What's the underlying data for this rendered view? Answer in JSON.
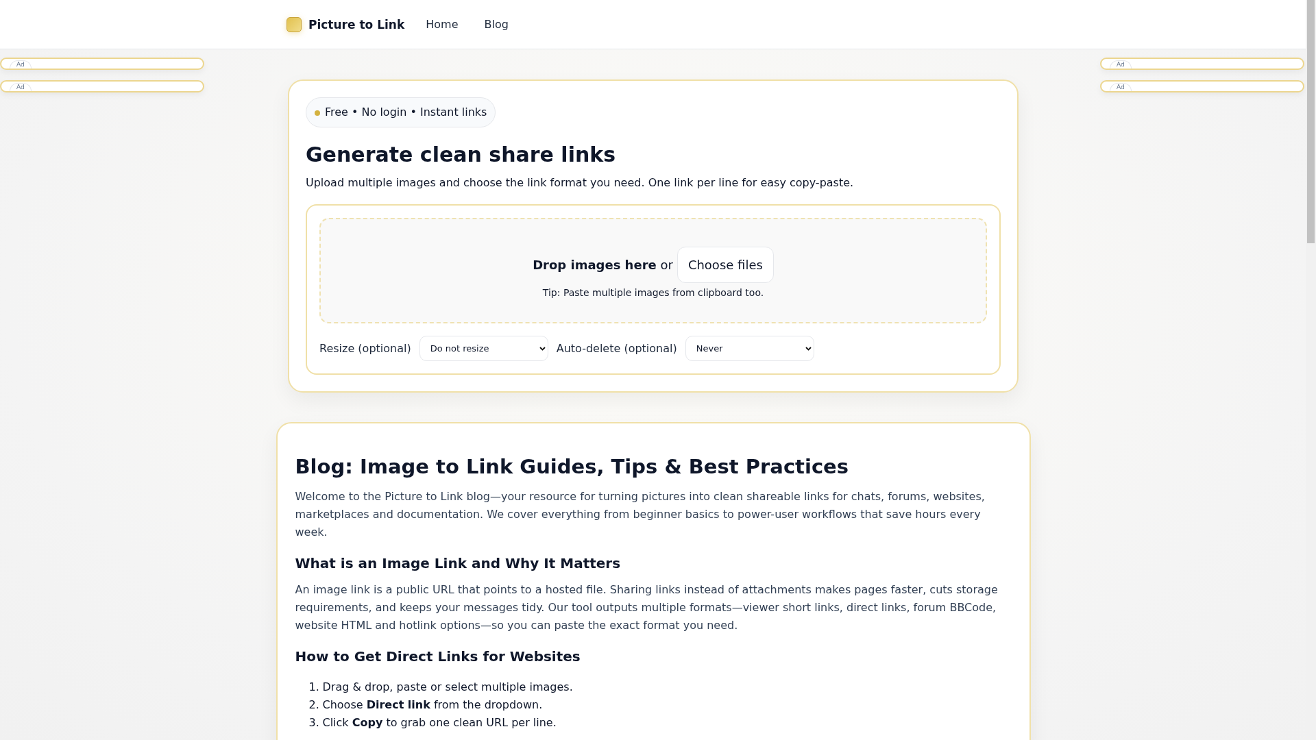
{
  "header": {
    "brand": "Picture to Link",
    "nav": [
      {
        "label": "Home"
      },
      {
        "label": "Blog"
      }
    ]
  },
  "ads": {
    "left": [
      "Ad",
      "Ad"
    ],
    "right": [
      "Ad",
      "Ad"
    ]
  },
  "tool": {
    "badge": "Free • No login • Instant links",
    "title": "Generate clean share links",
    "subtitle": "Upload multiple images and choose the link format you need. One link per line for easy copy-paste.",
    "drop": {
      "text": "**Drop images here** or",
      "button": "Choose files",
      "tip": "Tip: Paste multiple images from clipboard too."
    },
    "options": [
      {
        "label": "Resize (optional)",
        "value": "Do not resize"
      },
      {
        "label": "Auto-delete (optional)",
        "value": "Never"
      }
    ]
  },
  "blog": {
    "title": "Blog: Image to Link Guides, Tips & Best Practices",
    "blocks": [
      {
        "kind": "paragraph",
        "text": "Welcome to the Picture to Link blog—your resource for turning pictures into clean shareable links for chats, forums, websites, marketplaces and documentation. We cover everything from beginner basics to power-user workflows that save hours every week."
      },
      {
        "kind": "heading",
        "text": "What is an Image Link and Why It Matters"
      },
      {
        "kind": "paragraph",
        "text": "An image link is a public URL that points to a hosted file. Sharing links instead of attachments makes pages faster, cuts storage requirements, and keeps your messages tidy. Our tool outputs multiple formats—viewer short links, direct links, forum BBCode, website HTML and hotlink options—so you can paste the exact format you need."
      },
      {
        "kind": "heading",
        "text": "How to Get Direct Links for Websites"
      },
      {
        "kind": "list",
        "items": [
          {
            "number": "1.",
            "text": "Drag & drop, paste or select multiple images."
          },
          {
            "number": "2.",
            "text": "Choose **Direct link** from the dropdown."
          },
          {
            "number": "3.",
            "text": "Click **Copy** to grab one clean URL per line."
          }
        ]
      }
    ]
  }
}
